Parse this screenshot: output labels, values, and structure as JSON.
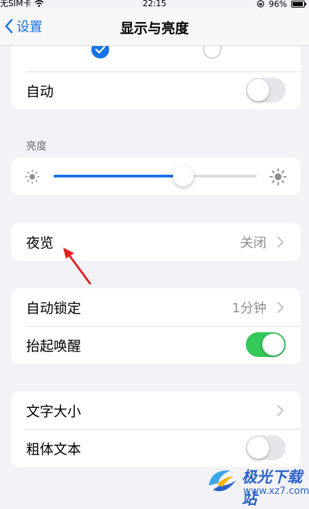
{
  "status_bar": {
    "carrier": "无SIM卡",
    "time": "22:15",
    "battery": "96%",
    "battery_level": 0.96
  },
  "nav": {
    "back_label": "设置",
    "title": "显示与亮度"
  },
  "appearance": {
    "light_selected": true,
    "auto_label": "自动",
    "auto_on": false
  },
  "brightness": {
    "section_label": "亮度",
    "level": 0.64
  },
  "night_shift": {
    "label": "夜览",
    "value": "关闭"
  },
  "auto_lock": {
    "label": "自动锁定",
    "value": "1分钟"
  },
  "raise_to_wake": {
    "label": "抬起唤醒",
    "on": true
  },
  "text_size": {
    "label": "文字大小"
  },
  "bold_text": {
    "label": "粗体文本",
    "on": false
  },
  "watermark": {
    "main": "极光下载站",
    "sub": "www.xz7.com"
  },
  "colors": {
    "accent": "#1673e6",
    "toggle_on": "#34c759",
    "arrow": "#e02020"
  }
}
